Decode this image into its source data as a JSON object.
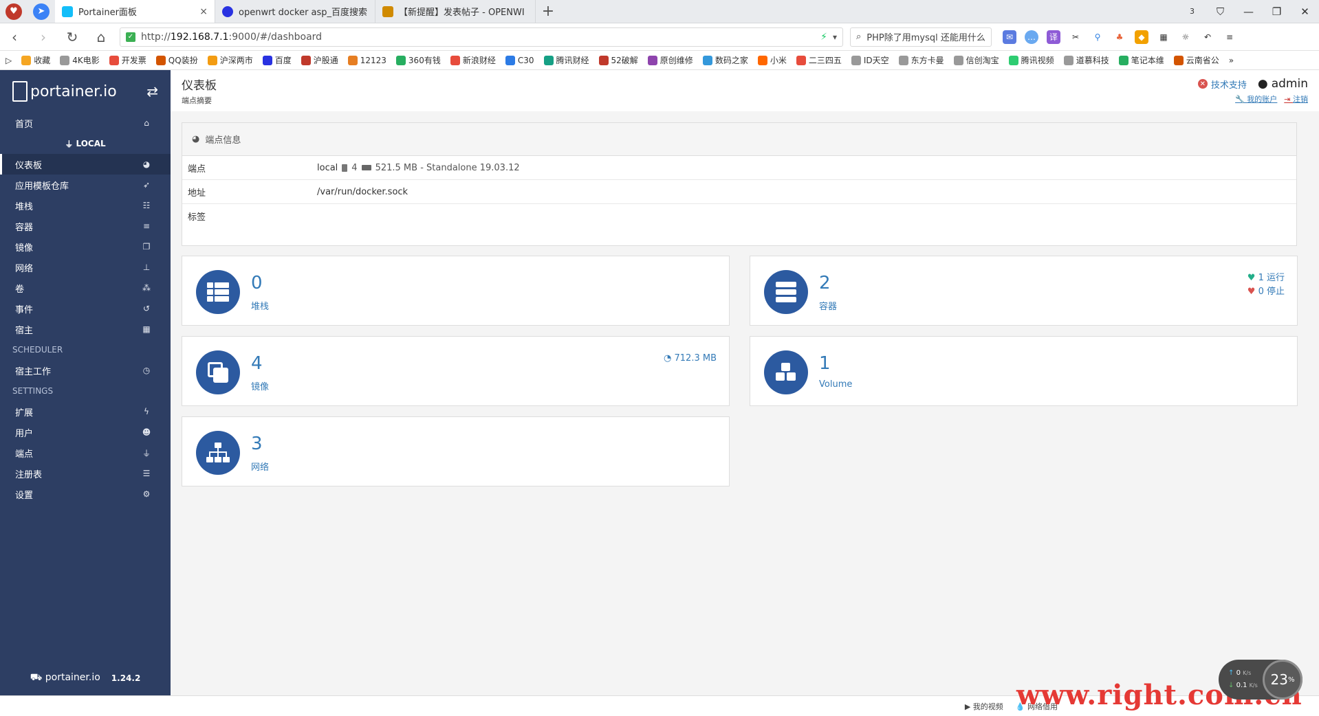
{
  "browser": {
    "tabs": [
      {
        "title": "Portainer面板",
        "close": "×",
        "active": true
      },
      {
        "title": "openwrt docker asp_百度搜索",
        "close": "",
        "active": false
      },
      {
        "title": "【新提醒】发表帖子 - OPENWI",
        "close": "",
        "active": false
      }
    ],
    "new_tab": "+",
    "window_badge": "3",
    "url_prefix": "http://",
    "url_host": "192.168.7.1",
    "url_rest": ":9000/#/dashboard",
    "search_text": "PHP除了用mysql 还能用什么",
    "bookmarks": [
      "收藏",
      "4K电影",
      "开发票",
      "QQ装扮",
      "沪深两市",
      "百度",
      "沪股通",
      "12123",
      "360有钱",
      "新浪财经",
      "C30",
      "腾讯财经",
      "52破解",
      "原创维修",
      "数码之家",
      "小米",
      "二三四五",
      "ID天空",
      "东方卡曼",
      "信创淘宝",
      "腾讯视频",
      "道慕科技",
      "笔记本维",
      "云南省公"
    ],
    "bookmark_more": "»"
  },
  "sidebar": {
    "brand": "portainer.io",
    "home": "首页",
    "endpoint": "LOCAL",
    "items": [
      {
        "label": "仪表板",
        "icon": "tachometer-icon",
        "glyph": "◕",
        "active": true
      },
      {
        "label": "应用模板仓库",
        "icon": "rocket-icon",
        "glyph": "➶"
      },
      {
        "label": "堆栈",
        "icon": "th-list-icon",
        "glyph": "☷"
      },
      {
        "label": "容器",
        "icon": "server-icon",
        "glyph": "≡"
      },
      {
        "label": "镜像",
        "icon": "clone-icon",
        "glyph": "❐"
      },
      {
        "label": "网络",
        "icon": "sitemap-icon",
        "glyph": "⊥"
      },
      {
        "label": "卷",
        "icon": "cubes-icon",
        "glyph": "⁂"
      },
      {
        "label": "事件",
        "icon": "history-icon",
        "glyph": "↺"
      },
      {
        "label": "宿主",
        "icon": "th-icon",
        "glyph": "▦"
      }
    ],
    "scheduler_title": "SCHEDULER",
    "scheduler_items": [
      {
        "label": "宿主工作",
        "icon": "clock-icon",
        "glyph": "◷"
      }
    ],
    "settings_title": "SETTINGS",
    "settings_items": [
      {
        "label": "扩展",
        "icon": "bolt-icon",
        "glyph": "ϟ"
      },
      {
        "label": "用户",
        "icon": "users-icon",
        "glyph": "☻"
      },
      {
        "label": "端点",
        "icon": "plug-icon",
        "glyph": "⏚"
      },
      {
        "label": "注册表",
        "icon": "database-icon",
        "glyph": "☰"
      },
      {
        "label": "设置",
        "icon": "cogs-icon",
        "glyph": "⚙"
      }
    ],
    "footer_brand": "portainer.io",
    "version": "1.24.2"
  },
  "header": {
    "title": "仪表板",
    "subtitle": "端点摘要",
    "support": "技术支持",
    "user": "admin",
    "my_account": "我的账户",
    "logout": "注销"
  },
  "endpoint_info": {
    "title": "端点信息",
    "rows": {
      "endpoint_key": "端点",
      "endpoint_name": "local",
      "cpu": "4",
      "memory_info": "521.5 MB - Standalone 19.03.12",
      "address_key": "地址",
      "address": "/var/run/docker.sock",
      "tags_key": "标签",
      "tags": ""
    }
  },
  "cards": {
    "stacks": {
      "count": "0",
      "label": "堆栈"
    },
    "containers": {
      "count": "2",
      "label": "容器",
      "running": "1 运行",
      "stopped": "0 停止"
    },
    "images": {
      "count": "4",
      "label": "镜像",
      "size": "712.3 MB"
    },
    "volumes": {
      "count": "1",
      "label": "Volume"
    },
    "networks": {
      "count": "3",
      "label": "网络"
    }
  },
  "statusbar": {
    "video": "我的视频",
    "network": "网络借用",
    "watermark": "www.right.com.cn",
    "speed_up": "0",
    "speed_down": "0.1",
    "speed_unit": "K/s",
    "percent": "23"
  },
  "colors": {
    "sidebar": "#2d3e63",
    "accent": "#337ab7",
    "card_icon": "#2c5aa0"
  }
}
